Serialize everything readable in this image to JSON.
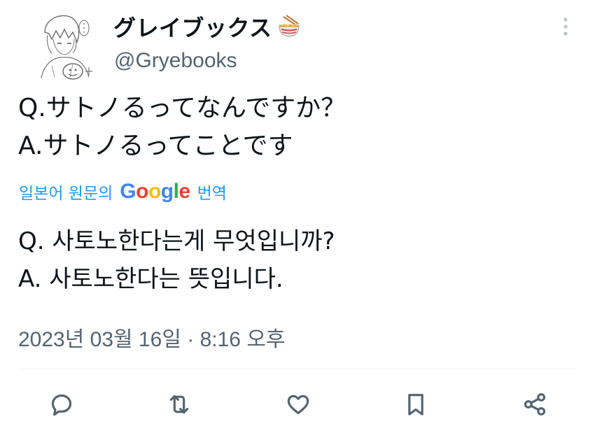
{
  "author": {
    "display_name": "グレイブックス",
    "handle": "@Gryebooks",
    "avatar_icon": "sketch-avatar-icon",
    "badge_icon": "ramen-bowl-icon"
  },
  "tweet": {
    "original_lines": [
      "Q.サトノるってなんですか？",
      "A.サトノるってことです"
    ],
    "translation_notice": {
      "prefix": "일본어 원문의",
      "provider": "Google",
      "suffix": "번역"
    },
    "translated_lines": [
      "Q. 사토노한다는게 무엇입니까?",
      "A. 사토노한다는 뜻입니다."
    ],
    "timestamp": "2023년 03월 16일 · 8:16 오후"
  },
  "actions": [
    {
      "name": "reply",
      "icon": "reply-icon"
    },
    {
      "name": "retweet",
      "icon": "retweet-icon"
    },
    {
      "name": "like",
      "icon": "heart-icon"
    },
    {
      "name": "bookmark",
      "icon": "bookmark-icon"
    },
    {
      "name": "share",
      "icon": "share-icon"
    }
  ],
  "colors": {
    "text": "#0f1419",
    "secondary": "#536471",
    "link": "#1d9bf0",
    "divider": "#eff3f4"
  }
}
